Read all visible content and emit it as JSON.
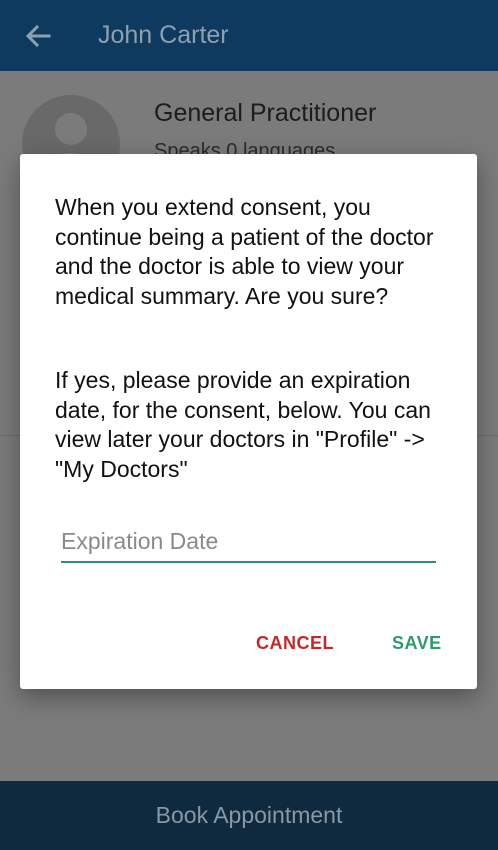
{
  "appbar": {
    "title": "John Carter"
  },
  "doctor": {
    "specialty": "General Practitioner",
    "languages": "Speaks 0 languages"
  },
  "dialog": {
    "message_1": "When you extend consent, you continue being a patient of the doctor and the doctor is able to view your medical summary. Are you sure?",
    "message_2": "If yes, please provide an expiration date, for the consent, below. You can view later your doctors in \"Profile\" -> \"My Doctors\"",
    "expiration_placeholder": "Expiration Date",
    "expiration_value": "",
    "cancel_label": "CANCEL",
    "save_label": "SAVE"
  },
  "bottom": {
    "book_label": "Book Appointment"
  },
  "colors": {
    "primary": "#0f3a5f",
    "accent_underline": "#2c8a8a",
    "cancel": "#c62828",
    "save": "#2e9a6a"
  },
  "icons": {
    "back": "arrow-back-icon",
    "avatar": "person-avatar-icon"
  }
}
